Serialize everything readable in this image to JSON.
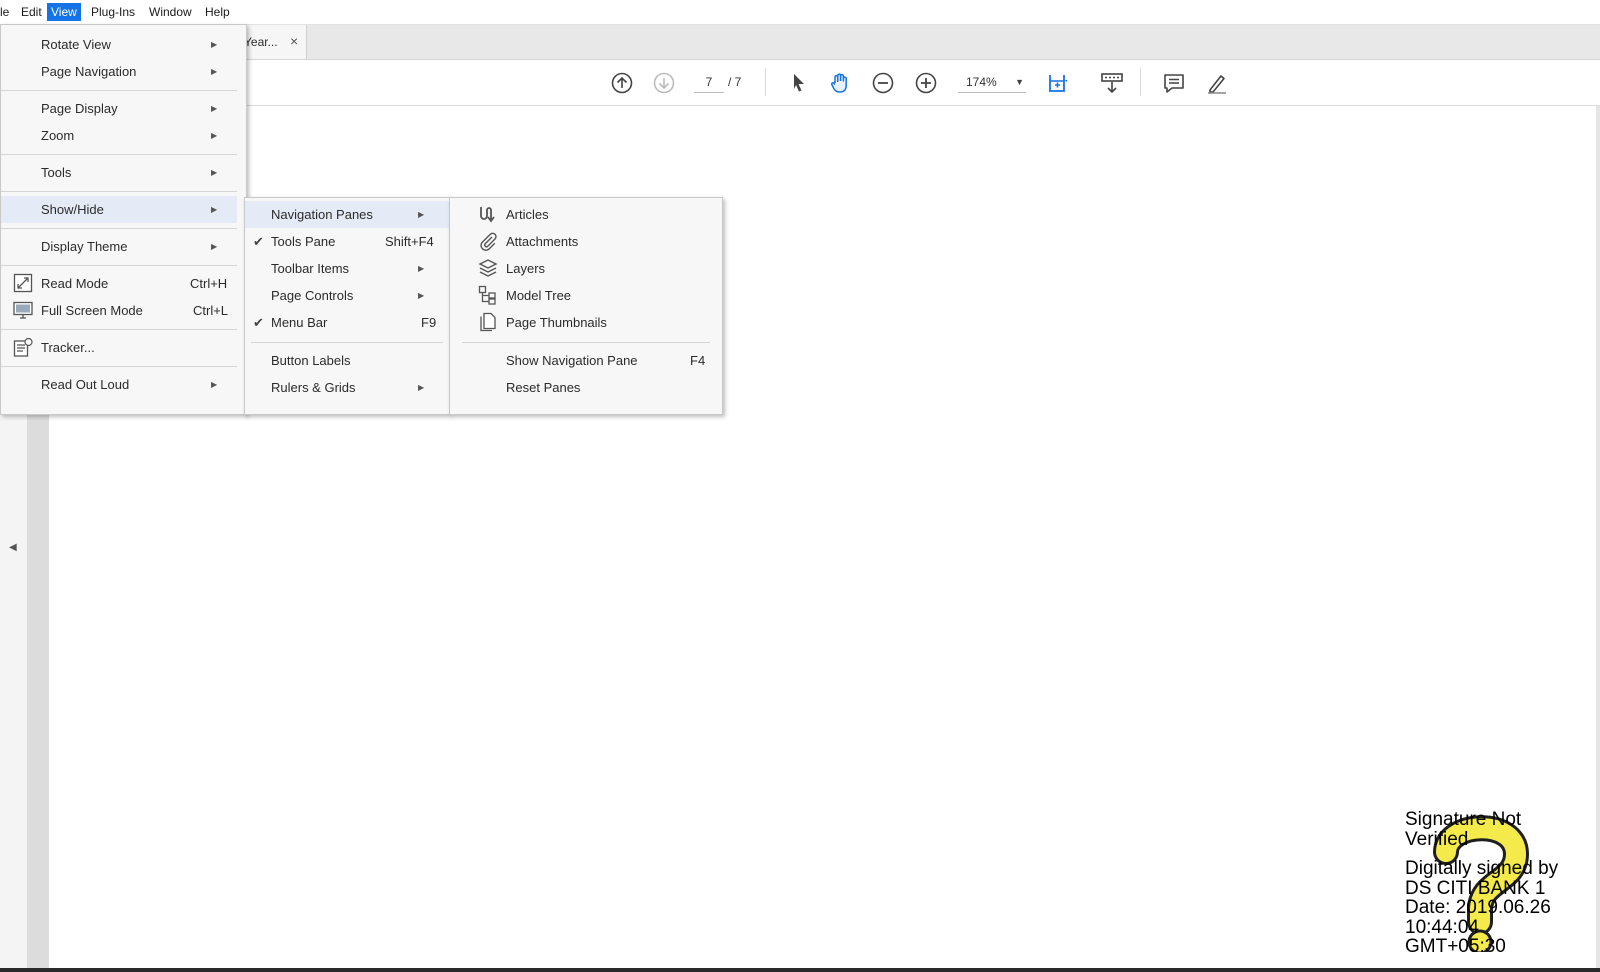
{
  "menubar": {
    "items": [
      "le",
      "Edit",
      "View",
      "Plug-Ins",
      "Window",
      "Help"
    ]
  },
  "tab": {
    "title": "Year...",
    "close": "×"
  },
  "toolbar": {
    "page_current": "7",
    "page_total": "/ 7",
    "zoom": "174%",
    "icons": [
      "previous-page-icon",
      "next-page-icon",
      "select-tool-icon",
      "hand-tool-icon",
      "zoom-out-icon",
      "zoom-in-icon",
      "fit-page-icon",
      "scroll-mode-icon",
      "comment-icon",
      "highlight-pen-icon"
    ]
  },
  "view_menu": {
    "items": [
      {
        "label": "Rotate View",
        "submenu": true
      },
      {
        "label": "Page Navigation",
        "submenu": true
      },
      {
        "label": "Page Display",
        "submenu": true
      },
      {
        "label": "Zoom",
        "submenu": true
      },
      {
        "label": "Tools",
        "submenu": true
      },
      {
        "label": "Show/Hide",
        "submenu": true
      },
      {
        "label": "Display Theme",
        "submenu": true
      },
      {
        "label": "Read Mode",
        "shortcut": "Ctrl+H",
        "icon": "read-mode-icon"
      },
      {
        "label": "Full Screen Mode",
        "shortcut": "Ctrl+L",
        "icon": "full-screen-icon"
      },
      {
        "label": "Tracker...",
        "icon": "tracker-icon"
      },
      {
        "label": "Read Out Loud",
        "submenu": true
      }
    ]
  },
  "showhide_menu": {
    "items": [
      {
        "label": "Navigation Panes",
        "submenu": true
      },
      {
        "label": "Tools Pane",
        "shortcut": "Shift+F4",
        "checked": true
      },
      {
        "label": "Toolbar Items",
        "submenu": true
      },
      {
        "label": "Page Controls",
        "submenu": true
      },
      {
        "label": "Menu Bar",
        "shortcut": "F9",
        "checked": true
      },
      {
        "label": "Button Labels"
      },
      {
        "label": "Rulers & Grids",
        "submenu": true
      }
    ]
  },
  "navpanes_menu": {
    "items": [
      {
        "label": "Articles",
        "icon": "articles-icon"
      },
      {
        "label": "Attachments",
        "icon": "attachment-icon"
      },
      {
        "label": "Layers",
        "icon": "layers-icon"
      },
      {
        "label": "Model Tree",
        "icon": "model-tree-icon"
      },
      {
        "label": "Page Thumbnails",
        "icon": "page-thumbnails-icon"
      },
      {
        "label": "Show Navigation Pane",
        "shortcut": "F4"
      },
      {
        "label": "Reset Panes"
      }
    ]
  },
  "signature": {
    "lines": [
      "Signature Not",
      "Verified",
      "Digitally signed by",
      "DS CITI BANK 1",
      "Date: 2019.06.26",
      "10:44:04",
      "GMT+05:30"
    ],
    "mark_color": "#f4ea4b"
  },
  "colors": {
    "accent": "#1473e6",
    "menu_bg": "#f7f7f7",
    "highlight": "#e4ebf6"
  }
}
